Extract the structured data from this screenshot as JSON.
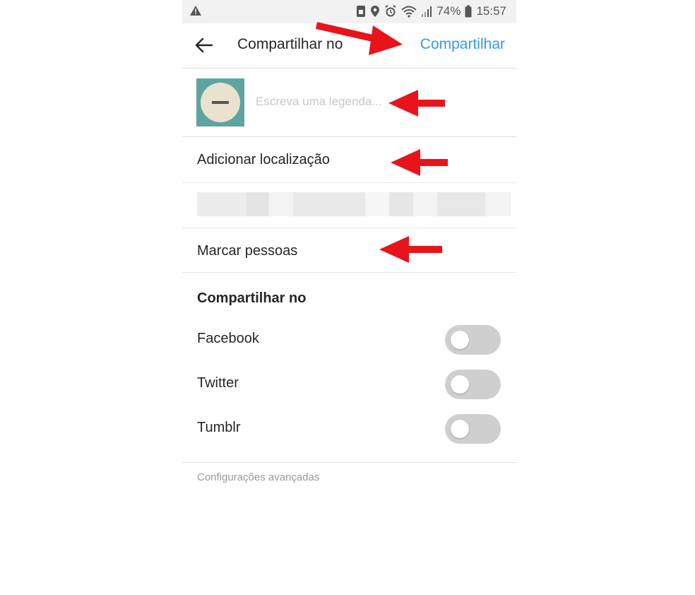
{
  "status_bar": {
    "battery": "74%",
    "time": "15:57"
  },
  "header": {
    "title": "Compartilhar no",
    "share_label": "Compartilhar"
  },
  "caption": {
    "placeholder": "Escreva uma legenda..."
  },
  "rows": {
    "add_location": "Adicionar localização",
    "tag_people": "Marcar pessoas"
  },
  "share_section": {
    "title": "Compartilhar no",
    "networks": [
      {
        "label": "Facebook",
        "enabled": false
      },
      {
        "label": "Twitter",
        "enabled": false
      },
      {
        "label": "Tumblr",
        "enabled": false
      }
    ]
  },
  "footer": {
    "advanced_settings": "Configurações avançadas"
  },
  "colors": {
    "accent": "#3897f0",
    "annotation_arrow": "#e8141b",
    "toggle_off": "#cfcfcf"
  },
  "icons": [
    "warning-icon",
    "back-arrow-icon",
    "alarm-icon",
    "location-icon",
    "wifi-icon",
    "signal-icon",
    "battery-icon",
    "sim-icon"
  ]
}
